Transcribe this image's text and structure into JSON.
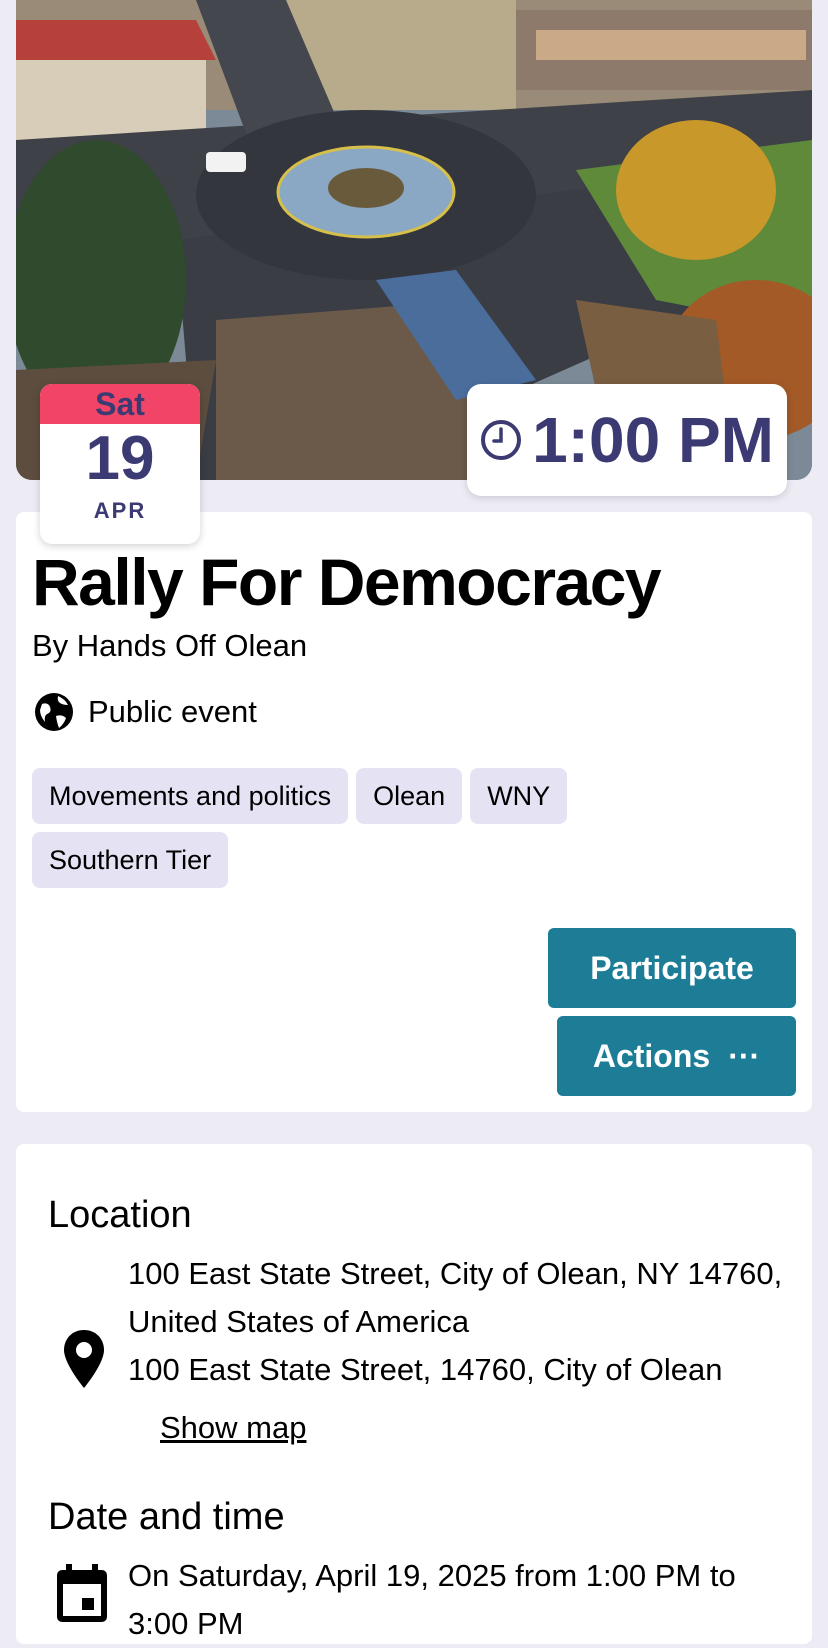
{
  "event": {
    "date": {
      "day_of_week": "Sat",
      "day": "19",
      "month": "APR"
    },
    "time": "1:00 PM",
    "title": "Rally For Democracy",
    "organizer": "By Hands Off Olean",
    "visibility": "Public event",
    "tags": [
      "Movements and politics",
      "Olean",
      "WNY",
      "Southern Tier"
    ]
  },
  "actions": {
    "participate_label": "Participate",
    "actions_label": "Actions",
    "more_glyph": "···"
  },
  "details": {
    "location_heading": "Location",
    "address_line1": "100 East State Street, City of Olean, NY 14760, United States of America",
    "address_line2": "100 East State Street, 14760, City of Olean",
    "show_map_label": "Show map",
    "datetime_heading": "Date and time",
    "datetime_text": "On Saturday, April 19, 2025 from 1:00 PM to 3:00 PM"
  },
  "icons": {
    "clock": "clock-icon",
    "globe": "globe-icon",
    "location": "location-pin-icon",
    "calendar": "calendar-icon"
  },
  "colors": {
    "accent_pink": "#f24466",
    "brand_violet": "#3c3a73",
    "button_teal": "#1e7d96",
    "tag_background": "#e4e2f3",
    "page_background": "#edecf5"
  }
}
